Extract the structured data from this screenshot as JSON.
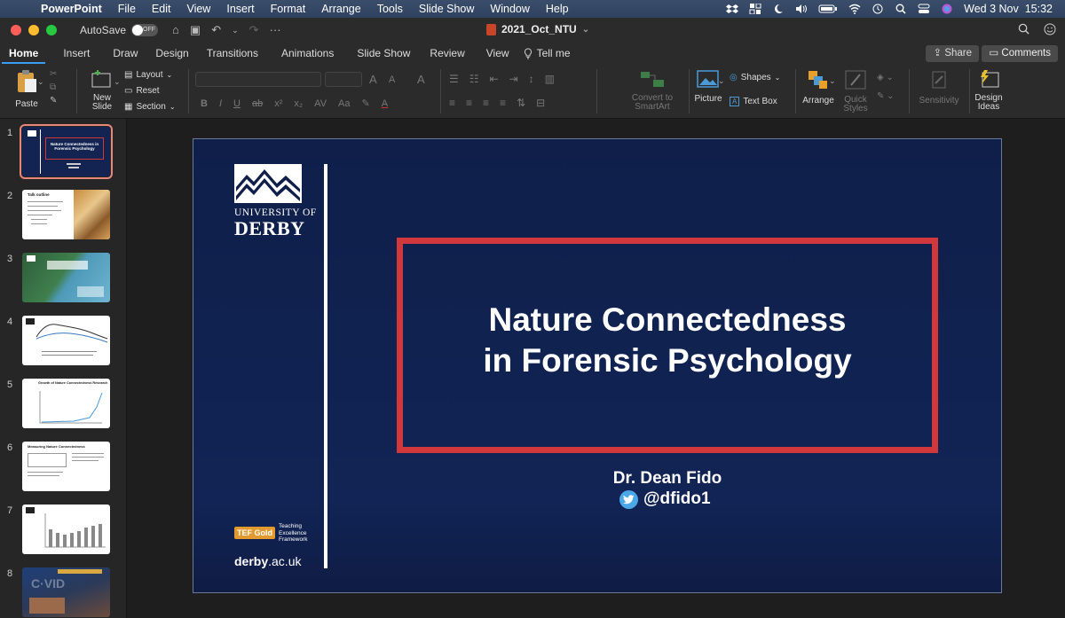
{
  "menubar": {
    "app": "PowerPoint",
    "items": [
      "File",
      "Edit",
      "View",
      "Insert",
      "Format",
      "Arrange",
      "Tools",
      "Slide Show",
      "Window",
      "Help"
    ],
    "clock": "Wed 3 Nov  15:32"
  },
  "titlebar": {
    "autosave_label": "AutoSave",
    "autosave_state": "OFF",
    "doc_title": "2021_Oct_NTU"
  },
  "tabs": [
    "Home",
    "Insert",
    "Draw",
    "Design",
    "Transitions",
    "Animations",
    "Slide Show",
    "Review",
    "View"
  ],
  "tell_me": "Tell me",
  "share_label": "Share",
  "comments_label": "Comments",
  "ribbon": {
    "paste": "Paste",
    "new_slide": "New\nSlide",
    "layout": "Layout",
    "reset": "Reset",
    "section": "Section",
    "convert_smartart": "Convert to\nSmartArt",
    "picture": "Picture",
    "shapes": "Shapes",
    "text_box": "Text Box",
    "arrange": "Arrange",
    "quick_styles": "Quick\nStyles",
    "sensitivity": "Sensitivity",
    "design_ideas": "Design\nIdeas"
  },
  "thumbnails": [
    {
      "num": "1",
      "title": "Nature Connectedness in Forensic Psychology",
      "kind": "title"
    },
    {
      "num": "2",
      "title": "Talk outline",
      "kind": "outline"
    },
    {
      "num": "3",
      "title": "",
      "kind": "aerial"
    },
    {
      "num": "4",
      "title": "",
      "kind": "graph"
    },
    {
      "num": "5",
      "title": "Growth of Nature Connectedness Research",
      "kind": "growth"
    },
    {
      "num": "6",
      "title": "Measuring Nature Connectedness",
      "kind": "measure"
    },
    {
      "num": "7",
      "title": "",
      "kind": "bars"
    },
    {
      "num": "8",
      "title": "",
      "kind": "covid"
    }
  ],
  "slide": {
    "logo_university_of": "UNIVERSITY OF",
    "logo_derby": "DERBY",
    "title_line1": "Nature Connectedness",
    "title_line2": "in Forensic Psychology",
    "author": "Dr. Dean Fido",
    "handle": "@dfido1",
    "tef_badge": "TEF Gold",
    "tef_text_1": "Teaching",
    "tef_text_2": "Excellence",
    "tef_text_3": "Framework",
    "site_bold": "derby",
    "site_rest": ".ac.uk"
  }
}
